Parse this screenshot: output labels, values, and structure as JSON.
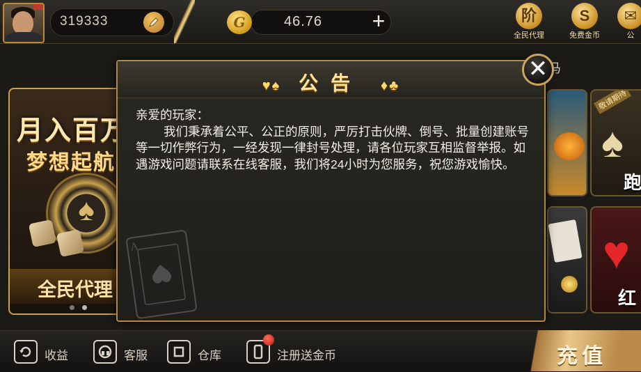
{
  "header": {
    "user_id": "319333",
    "coin_balance": "46.76",
    "add_coins_label": "+",
    "icons": [
      {
        "name": "agent-icon",
        "glyph": "阶",
        "label": "全民代理"
      },
      {
        "name": "free-coins-icon",
        "glyph": "S",
        "label": "免费金币"
      },
      {
        "name": "mail-icon",
        "glyph": "✉",
        "label": "公"
      }
    ]
  },
  "lobby": {
    "banner_title": "月入百万",
    "banner_subtitle": "梦想起航",
    "banner_footer": "全民代理",
    "peek_text": "马",
    "tile_text_1": "跑",
    "tile_text_2": "红",
    "tile_badge": "敬请期待",
    "bottom_gold_text": "充值"
  },
  "bottom_bar": {
    "items": [
      {
        "name": "earnings",
        "label": "收益"
      },
      {
        "name": "customer-service",
        "label": "客服"
      },
      {
        "name": "warehouse",
        "label": "仓库"
      },
      {
        "name": "register-bonus",
        "label": "注册送金币"
      }
    ]
  },
  "dialog": {
    "title": "公告",
    "suits_left": "♥♠",
    "suits_right": "♦♣",
    "greeting": "亲爱的玩家：",
    "body": "我们秉承着公平、公正的原则，严厉打击伙牌、倒号、批量创建账号等一切作弊行为，一经发现一律封号处理，请各位玩家互相监督举报。如遇游戏问题请联系在线客服，我们将24小时为您服务，祝您游戏愉快。",
    "close_label": "✕",
    "deco_card_rank": "A"
  },
  "colors": {
    "gold_accent": "#c9a14c",
    "title_gold": "#ffe49a",
    "panel_bg": "#1f1e1b",
    "text_light": "#f2efe9"
  }
}
